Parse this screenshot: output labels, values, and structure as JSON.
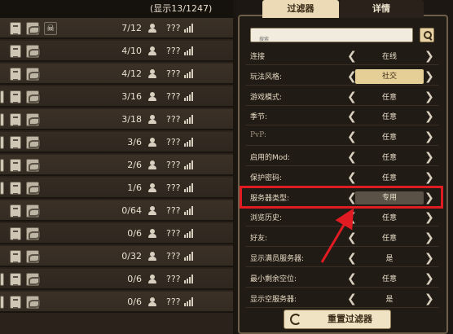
{
  "list": {
    "count_text": "(显示13/1247)",
    "rows": [
      {
        "players": "7/12",
        "ping": "???",
        "skull": true,
        "cut": false
      },
      {
        "players": "4/10",
        "ping": "???",
        "skull": false,
        "cut": false
      },
      {
        "players": "4/12",
        "ping": "???",
        "skull": false,
        "cut": false
      },
      {
        "players": "3/16",
        "ping": "???",
        "skull": false,
        "cut": true
      },
      {
        "players": "3/18",
        "ping": "???",
        "skull": false,
        "cut": true
      },
      {
        "players": "3/6",
        "ping": "???",
        "skull": false,
        "cut": true
      },
      {
        "players": "2/6",
        "ping": "???",
        "skull": false,
        "cut": true
      },
      {
        "players": "1/6",
        "ping": "???",
        "skull": false,
        "cut": true
      },
      {
        "players": "0/64",
        "ping": "???",
        "skull": false,
        "cut": false
      },
      {
        "players": "0/6",
        "ping": "???",
        "skull": false,
        "cut": false
      },
      {
        "players": "0/32",
        "ping": "???",
        "skull": false,
        "cut": false
      },
      {
        "players": "0/6",
        "ping": "???",
        "skull": false,
        "cut": true
      },
      {
        "players": "0/6",
        "ping": "???",
        "skull": false,
        "cut": true
      }
    ]
  },
  "tabs": {
    "filter": "过滤器",
    "details": "详情"
  },
  "search": {
    "placeholder": "搜索"
  },
  "filters": [
    {
      "label": "连接",
      "value": "在线",
      "style": "plain"
    },
    {
      "label": "玩法风格:",
      "value": "社交",
      "style": "pill"
    },
    {
      "label": "游戏模式:",
      "value": "任意",
      "style": "plain"
    },
    {
      "label": "季节:",
      "value": "任意",
      "style": "plain"
    },
    {
      "label": "PvP:",
      "value": "任意",
      "style": "plain",
      "faded": true
    },
    {
      "label": "启用的Mod:",
      "value": "任意",
      "style": "plain"
    },
    {
      "label": "保护密码:",
      "value": "任意",
      "style": "plain"
    },
    {
      "label": "服务器类型:",
      "value": "专用",
      "style": "grey"
    },
    {
      "label": "浏览历史:",
      "value": "任意",
      "style": "plain"
    },
    {
      "label": "好友:",
      "value": "任意",
      "style": "plain"
    },
    {
      "label": "显示满员服务器:",
      "value": "是",
      "style": "plain"
    },
    {
      "label": "最小剩余空位:",
      "value": "任意",
      "style": "plain"
    },
    {
      "label": "显示空服务器:",
      "value": "是",
      "style": "plain"
    }
  ],
  "reset_button": "重置过滤器",
  "colors": {
    "highlight": "#e11b22",
    "accent": "#e6cf96"
  }
}
